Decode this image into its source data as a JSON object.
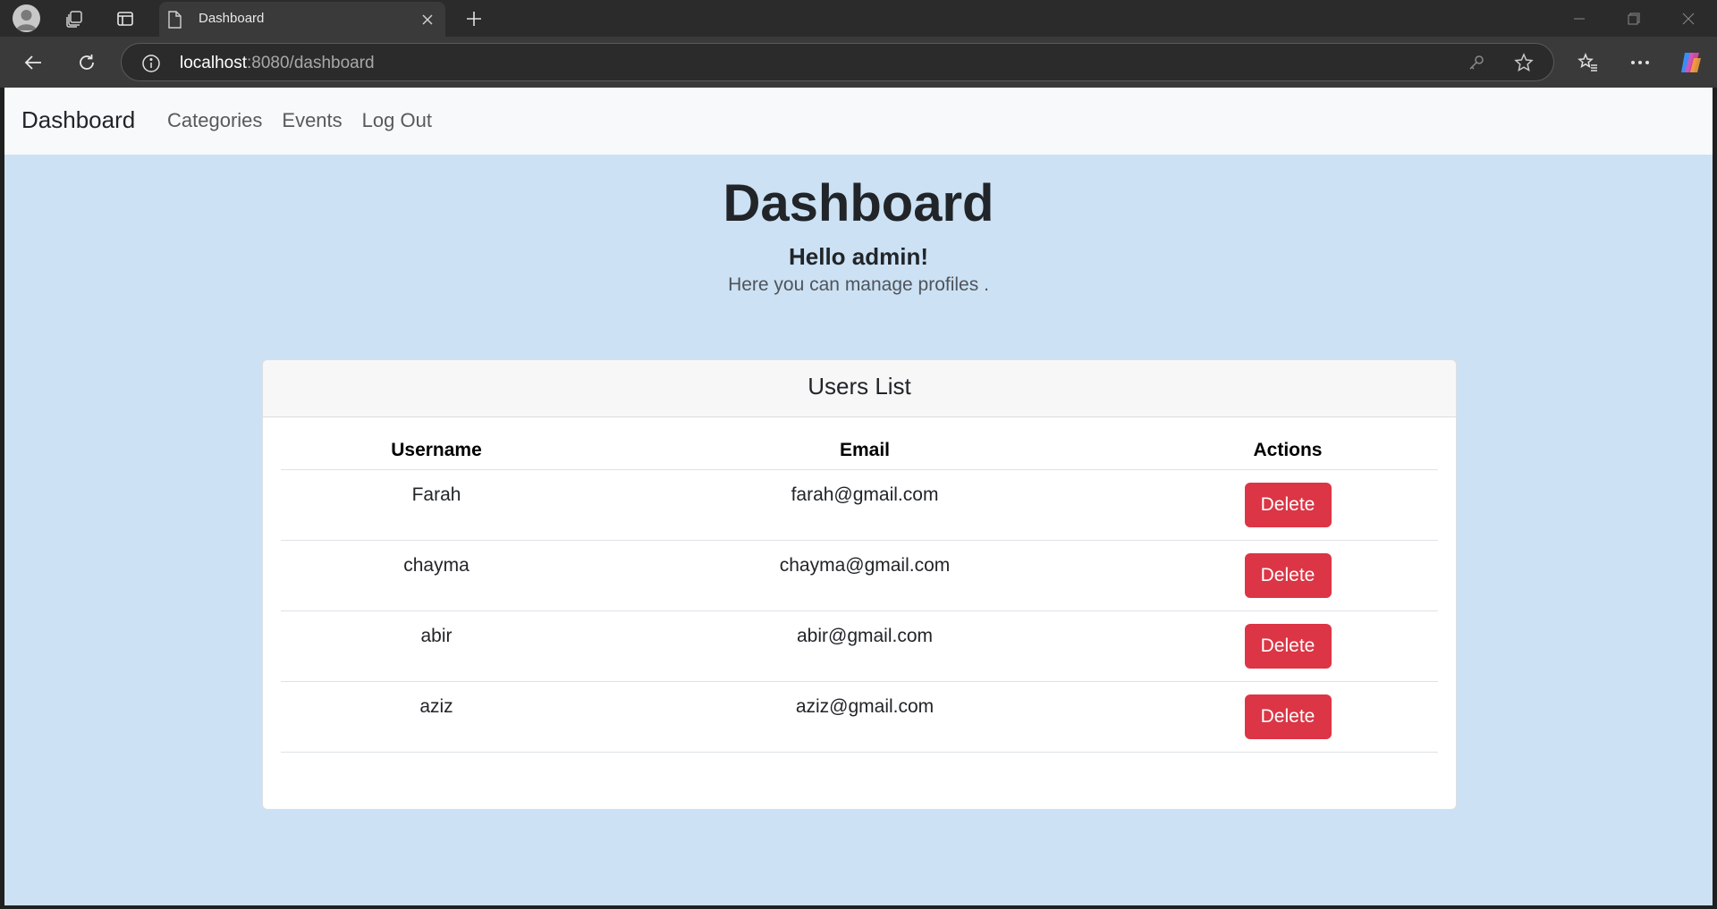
{
  "browser": {
    "tab_title": "Dashboard",
    "url_host": "localhost",
    "url_rest": ":8080/dashboard"
  },
  "navbar": {
    "brand": "Dashboard",
    "links": [
      "Categories",
      "Events",
      "Log Out"
    ]
  },
  "hero": {
    "title": "Dashboard",
    "greeting": "Hello admin!",
    "subtitle": "Here you can manage profiles ."
  },
  "users_card": {
    "title": "Users List",
    "columns": [
      "Username",
      "Email",
      "Actions"
    ],
    "rows": [
      {
        "username": "Farah",
        "email": "farah@gmail.com",
        "action": "Delete"
      },
      {
        "username": "chayma",
        "email": "chayma@gmail.com",
        "action": "Delete"
      },
      {
        "username": "abir",
        "email": "abir@gmail.com",
        "action": "Delete"
      },
      {
        "username": "aziz",
        "email": "aziz@gmail.com",
        "action": "Delete"
      }
    ]
  },
  "colors": {
    "page_bg": "#cce1f4",
    "danger": "#dc3545",
    "navbar_bg": "#f8f9fa"
  }
}
